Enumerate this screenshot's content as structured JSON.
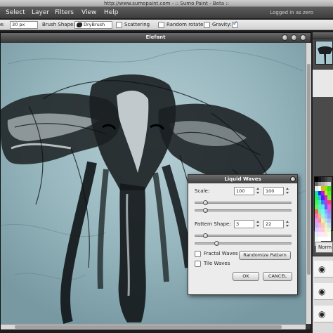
{
  "browser": {
    "title": "http://www.sumopaint.com - :: Sumo Paint - Beta ::"
  },
  "menubar": {
    "items": [
      "Select",
      "Layer",
      "Filters",
      "View",
      "Help"
    ],
    "status": "Logged in as zero"
  },
  "toolbar": {
    "size_value": "30 px",
    "brush_shape_label": "Brush Shape:",
    "brush_shape_value": "DryBrush",
    "scattering_label": "Scattering",
    "random_rotate_label": "Random rotate",
    "gravity_label": "Gravity:",
    "scattering_checked": false,
    "random_rotate_checked": false,
    "gravity_checked": true
  },
  "document": {
    "title": "Elefant"
  },
  "layers": {
    "blend_mode": "Norm"
  },
  "dialog": {
    "title": "Liquid Waves",
    "scale_label": "Scale:",
    "scale_x": "100",
    "scale_y": "100",
    "scale_slider_1_pct": 10,
    "scale_slider_2_pct": 10,
    "pattern_label": "Pattern Shape:",
    "pattern_a": "3",
    "pattern_b": "22",
    "pattern_slider_1_pct": 10,
    "pattern_slider_2_pct": 22,
    "fractal_label": "Fractal Waves",
    "tile_label": "Tile Waves",
    "fractal_checked": false,
    "tile_checked": false,
    "randomize_label": "Randomize Pattern",
    "ok_label": "OK",
    "cancel_label": "CANCEL"
  },
  "colors": {
    "canvas_bg": "#8fb0b8",
    "ink": "#111111",
    "ui_dark": "#3c3c3c"
  }
}
